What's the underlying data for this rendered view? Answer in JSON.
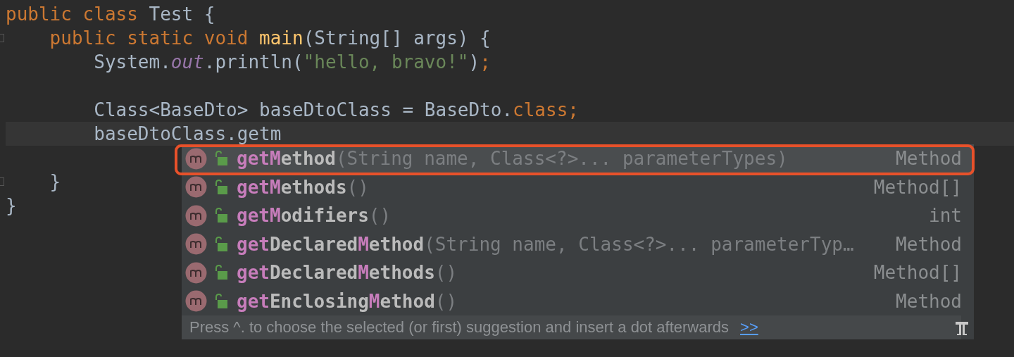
{
  "editor": {
    "lines": [
      {
        "current": false,
        "fold": false,
        "blank_before": false,
        "tokens": [
          {
            "kind": "keyword",
            "text": "public class "
          },
          {
            "kind": "plain",
            "text": "Test {"
          }
        ]
      },
      {
        "current": false,
        "fold": true,
        "blank_before": false,
        "tokens": [
          {
            "kind": "keyword",
            "text": "    public static void "
          },
          {
            "kind": "declaration",
            "text": "main"
          },
          {
            "kind": "plain",
            "text": "(String[] args) {"
          }
        ]
      },
      {
        "current": false,
        "fold": false,
        "blank_before": false,
        "tokens": [
          {
            "kind": "plain",
            "text": "        System."
          },
          {
            "kind": "field",
            "text": "out"
          },
          {
            "kind": "plain",
            "text": ".println("
          },
          {
            "kind": "string",
            "text": "\"hello, bravo!\""
          },
          {
            "kind": "plain",
            "text": ")"
          },
          {
            "kind": "keyword",
            "text": ";"
          }
        ]
      },
      {
        "current": false,
        "fold": false,
        "blank_before": true,
        "tokens": [
          {
            "kind": "plain",
            "text": "        Class<BaseDto> baseDtoClass = BaseDto."
          },
          {
            "kind": "keyword",
            "text": "class;"
          }
        ]
      },
      {
        "current": true,
        "fold": false,
        "blank_before": false,
        "tokens": [
          {
            "kind": "plain",
            "text": "        baseDtoClass.getm"
          }
        ]
      },
      {
        "current": false,
        "fold": true,
        "blank_before": true,
        "tokens": [
          {
            "kind": "plain",
            "text": "    }"
          }
        ]
      },
      {
        "current": false,
        "fold": false,
        "blank_before": false,
        "tokens": [
          {
            "kind": "plain",
            "text": "}"
          }
        ]
      }
    ]
  },
  "completion": {
    "items": [
      {
        "selected": true,
        "name_parts": [
          {
            "text": "get",
            "matched": true
          },
          {
            "text": "M",
            "matched": true
          },
          {
            "text": "ethod",
            "matched": false
          }
        ],
        "params": "(String name, Class<?>... parameterTypes)",
        "type": "Method"
      },
      {
        "selected": false,
        "name_parts": [
          {
            "text": "get",
            "matched": true
          },
          {
            "text": "M",
            "matched": true
          },
          {
            "text": "ethods",
            "matched": false
          }
        ],
        "params": "()",
        "type": "Method[]"
      },
      {
        "selected": false,
        "name_parts": [
          {
            "text": "get",
            "matched": true
          },
          {
            "text": "M",
            "matched": true
          },
          {
            "text": "odifiers",
            "matched": false
          }
        ],
        "params": "()",
        "type": "int"
      },
      {
        "selected": false,
        "name_parts": [
          {
            "text": "get",
            "matched": true
          },
          {
            "text": "Declared",
            "matched": false
          },
          {
            "text": "M",
            "matched": true
          },
          {
            "text": "ethod",
            "matched": false
          }
        ],
        "params": "(String name, Class<?>... parameterTyp…",
        "type": "Method"
      },
      {
        "selected": false,
        "name_parts": [
          {
            "text": "get",
            "matched": true
          },
          {
            "text": "Declared",
            "matched": false
          },
          {
            "text": "M",
            "matched": true
          },
          {
            "text": "ethods",
            "matched": false
          }
        ],
        "params": "()",
        "type": "Method[]"
      },
      {
        "selected": false,
        "name_parts": [
          {
            "text": "get",
            "matched": true
          },
          {
            "text": "Enclosing",
            "matched": false
          },
          {
            "text": "M",
            "matched": true
          },
          {
            "text": "ethod",
            "matched": false
          }
        ],
        "params": "()",
        "type": "Method"
      }
    ],
    "footer": {
      "hint": "Press ^. to choose the selected (or first) suggestion and insert a dot afterwards",
      "link": ">>"
    }
  }
}
